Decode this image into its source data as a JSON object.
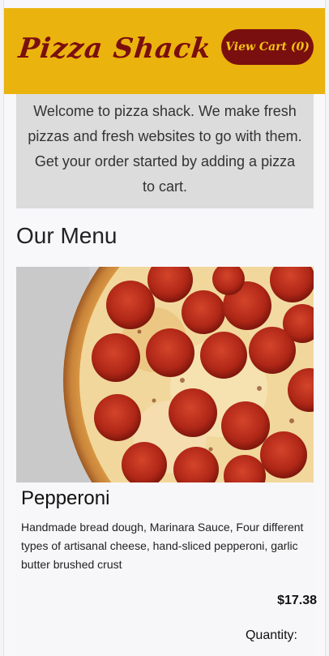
{
  "header": {
    "brand": "Pizza Shack",
    "cart_button_label": "View Cart (0)"
  },
  "welcome": {
    "text": "Welcome to pizza shack. We make fresh pizzas and fresh websites to go with them. Get your order started by adding a pizza to cart."
  },
  "menu": {
    "title": "Our Menu",
    "items": [
      {
        "name": "Pepperoni",
        "description": "Handmade bread dough, Marinara Sauce, Four different types of artisanal cheese, hand-sliced pepperoni, garlic butter brushed crust",
        "price": "$17.38",
        "quantity_label": "Quantity:"
      }
    ]
  },
  "colors": {
    "header_bg": "#eab30d",
    "brand": "#7a0f0f",
    "cart_button_bg": "#7a0f0f",
    "cart_button_text": "#f3c312",
    "welcome_bg": "#dcdcdc"
  }
}
